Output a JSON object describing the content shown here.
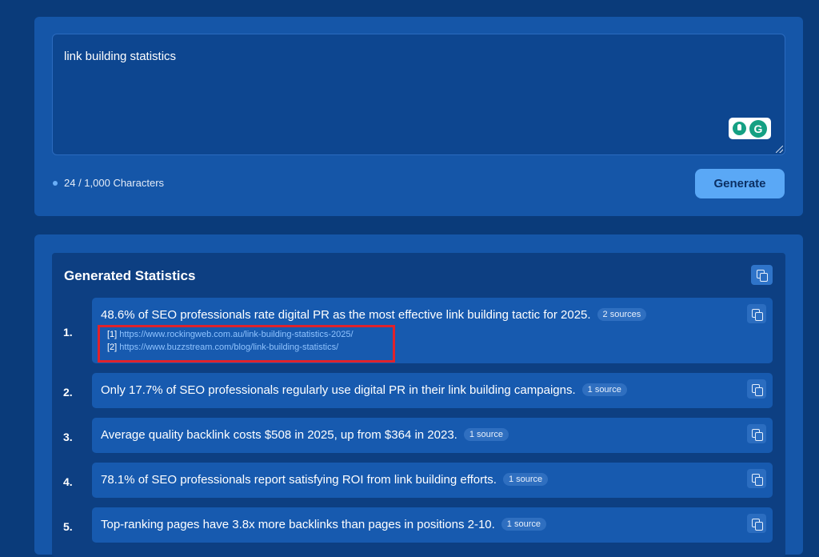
{
  "prompt": {
    "value": "link building statistics",
    "char_count": "24 / 1,000 Characters",
    "generate_label": "Generate"
  },
  "results": {
    "title": "Generated Statistics",
    "items": [
      {
        "num": "1.",
        "text": "48.6% of SEO professionals rate digital PR as the most effective link building tactic for 2025.",
        "badge": "2 sources",
        "sources": [
          {
            "idx": "[1]",
            "url": "https://www.rockingweb.com.au/link-building-statistics-2025/"
          },
          {
            "idx": "[2]",
            "url": "https://www.buzzstream.com/blog/link-building-statistics/"
          }
        ]
      },
      {
        "num": "2.",
        "text": "Only 17.7% of SEO professionals regularly use digital PR in their link building campaigns.",
        "badge": "1 source"
      },
      {
        "num": "3.",
        "text": "Average quality backlink costs $508 in 2025, up from $364 in 2023.",
        "badge": "1 source"
      },
      {
        "num": "4.",
        "text": "78.1% of SEO professionals report satisfying ROI from link building efforts.",
        "badge": "1 source"
      },
      {
        "num": "5.",
        "text": "Top-ranking pages have 3.8x more backlinks than pages in positions 2-10.",
        "badge": "1 source"
      }
    ]
  },
  "colors": {
    "background": "#0a3b7a",
    "card": "#1556a8",
    "accent": "#5aa8f6",
    "highlight": "#e0222b",
    "link": "#8fc3ff"
  }
}
